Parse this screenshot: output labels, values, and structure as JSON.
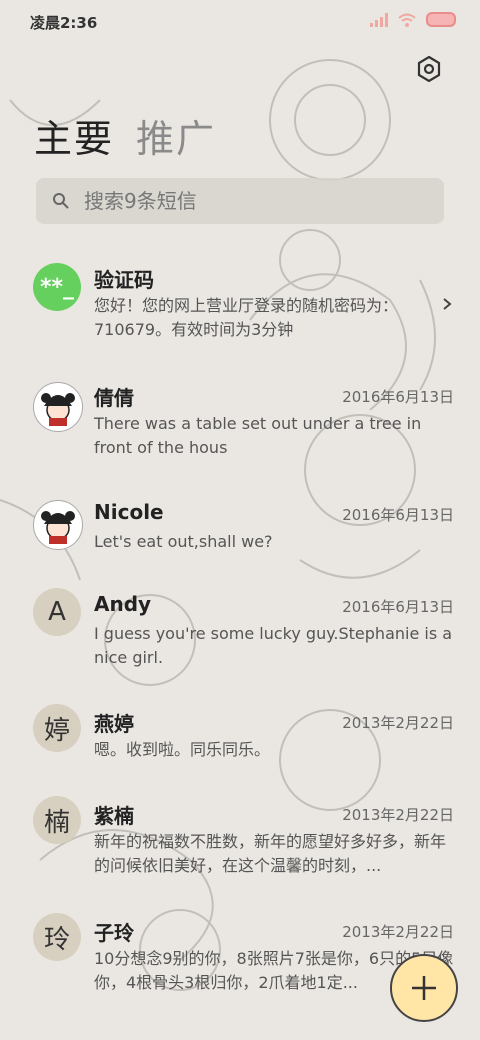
{
  "status_bar": {
    "time": "凌晨2:36"
  },
  "header": {
    "tabs": [
      {
        "label": "主要"
      },
      {
        "label": "推广"
      }
    ]
  },
  "search": {
    "placeholder": "搜索9条短信"
  },
  "conversations": [
    {
      "avatar": "**_",
      "name": "验证码",
      "date": "",
      "preview": "您好！您的网上营业厅登录的随机密码为：710679。有效时间为3分钟"
    },
    {
      "avatar": "",
      "name": "倩倩",
      "date": "2016年6月13日",
      "preview": "There was a table set out under a tree in front of the hous"
    },
    {
      "avatar": "",
      "name": "Nicole",
      "date": "2016年6月13日",
      "preview": "Let's eat out,shall we?"
    },
    {
      "avatar": "A",
      "name": "Andy",
      "date": "2016年6月13日",
      "preview": "I guess you're some lucky guy.Stephanie is a nice girl."
    },
    {
      "avatar": "婷",
      "name": "燕婷",
      "date": "2013年2月22日",
      "preview": "嗯。收到啦。同乐同乐。"
    },
    {
      "avatar": "楠",
      "name": "紫楠",
      "date": "2013年2月22日",
      "preview": "新年的祝福数不胜数，新年的愿望好多好多，新年的问候依旧美好，在这个温馨的时刻，..."
    },
    {
      "avatar": "玲",
      "name": "子玲",
      "date": "2013年2月22日",
      "preview": "10分想念9别的你，8张照片7张是你，6只的5只像你，4根骨头3根归你，2爪着地1定..."
    }
  ],
  "colors": {
    "background": "#eae7e2",
    "fab": "#ffe5a6",
    "avatar_green": "#66d05e",
    "avatar_letter": "#d7cfbf"
  }
}
